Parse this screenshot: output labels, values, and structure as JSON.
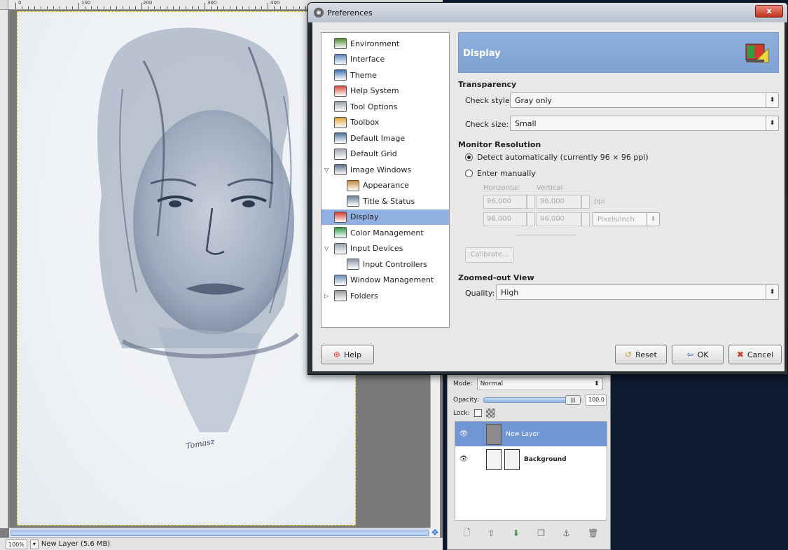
{
  "dialog": {
    "title": "Preferences",
    "close_label": "x",
    "tree": [
      {
        "label": "Environment",
        "name": "tree-item-environment",
        "icon": "environment-icon",
        "color": "#4b8b2f"
      },
      {
        "label": "Interface",
        "name": "tree-item-interface",
        "icon": "interface-icon",
        "color": "#5b84c4"
      },
      {
        "label": "Theme",
        "name": "tree-item-theme",
        "icon": "theme-icon",
        "color": "#3e6fb6"
      },
      {
        "label": "Help System",
        "name": "tree-item-help-system",
        "icon": "lifebuoy-icon",
        "color": "#d64b3a"
      },
      {
        "label": "Tool Options",
        "name": "tree-item-tool-options",
        "icon": "tool-options-icon",
        "color": "#9aa1ab"
      },
      {
        "label": "Toolbox",
        "name": "tree-item-toolbox",
        "icon": "toolbox-icon",
        "color": "#e0a43a"
      },
      {
        "label": "Default Image",
        "name": "tree-item-default-image",
        "icon": "default-image-icon",
        "color": "#4d6f9c"
      },
      {
        "label": "Default Grid",
        "name": "tree-item-default-grid",
        "icon": "grid-icon",
        "color": "#a4a9b3"
      },
      {
        "label": "Image Windows",
        "name": "tree-item-image-windows",
        "icon": "image-windows-icon",
        "color": "#5a6e8f"
      },
      {
        "label": "Appearance",
        "name": "tree-item-appearance",
        "icon": "appearance-icon",
        "color": "#c28a38"
      },
      {
        "label": "Title & Status",
        "name": "tree-item-title-status",
        "icon": "title-status-icon",
        "color": "#6e7f99"
      },
      {
        "label": "Display",
        "name": "tree-item-display",
        "icon": "display-icon",
        "color": "#d23b2b"
      },
      {
        "label": "Color Management",
        "name": "tree-item-color-management",
        "icon": "color-management-icon",
        "color": "#2f9e45"
      },
      {
        "label": "Input Devices",
        "name": "tree-item-input-devices",
        "icon": "input-devices-icon",
        "color": "#9aa1ab"
      },
      {
        "label": "Input Controllers",
        "name": "tree-item-input-controllers",
        "icon": "input-controllers-icon",
        "color": "#8c96a8"
      },
      {
        "label": "Window Management",
        "name": "tree-item-window-management",
        "icon": "window-management-icon",
        "color": "#6d88b3"
      },
      {
        "label": "Folders",
        "name": "tree-item-folders",
        "icon": "folder-icon",
        "color": "#9a9a9a"
      }
    ],
    "display": {
      "header": "Display",
      "transparency": {
        "title": "Transparency",
        "check_style_label": "Check style:",
        "check_style_value": "Gray only",
        "check_size_label": "Check size:",
        "check_size_value": "Small"
      },
      "monitor": {
        "title": "Monitor Resolution",
        "detect_label": "Detect automatically (currently 96 × 96 ppi)",
        "manual_label": "Enter manually",
        "horizontal_label": "Horizontal",
        "vertical_label": "Vertical",
        "h1": "96,000",
        "v1": "96,000",
        "ppi_label": "ppi",
        "h2": "96,000",
        "v2": "96,000",
        "unit_value": "Pixels/inch",
        "calibrate_label": "Calibrate..."
      },
      "zoomed": {
        "title": "Zoomed-out View",
        "quality_label": "Quality:",
        "quality_value": "High"
      }
    },
    "buttons": {
      "help": "Help",
      "reset": "Reset",
      "ok": "OK",
      "cancel": "Cancel"
    }
  },
  "image_window": {
    "ruler_labels": [
      "0",
      "100",
      "200",
      "300",
      "400"
    ],
    "zoom_value": "100%",
    "status_text": "New Layer (5.6 MB)",
    "signature": "Tomasz"
  },
  "layers": {
    "mode_label": "Mode:",
    "mode_value": "Normal",
    "opacity_label": "Opacity:",
    "opacity_value": "100,0",
    "lock_label": "Lock:",
    "items": [
      {
        "name": "New Layer",
        "selected": true
      },
      {
        "name": "Background",
        "selected": false
      }
    ]
  },
  "colors": {
    "accent": "#7fa2d4",
    "selection": "#8fb0e0",
    "desktop": "#0e1a30"
  }
}
